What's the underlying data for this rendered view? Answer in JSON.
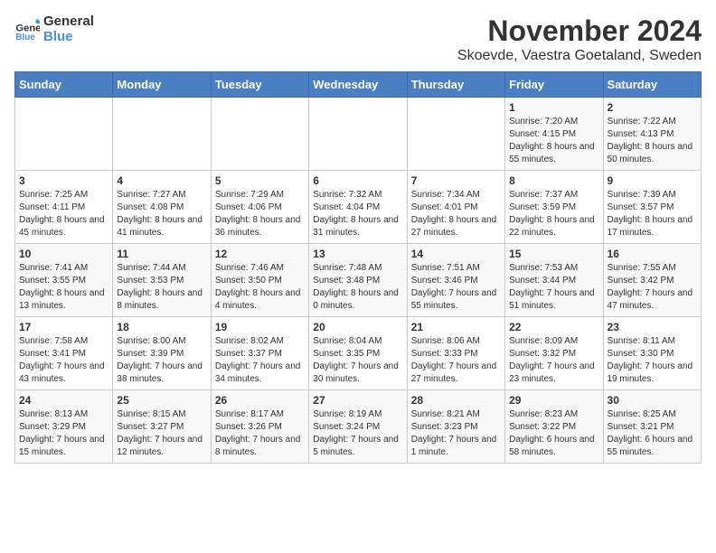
{
  "header": {
    "logo_line1": "General",
    "logo_line2": "Blue",
    "month": "November 2024",
    "location": "Skoevde, Vaestra Goetaland, Sweden"
  },
  "days_of_week": [
    "Sunday",
    "Monday",
    "Tuesday",
    "Wednesday",
    "Thursday",
    "Friday",
    "Saturday"
  ],
  "weeks": [
    [
      {
        "day": "",
        "info": ""
      },
      {
        "day": "",
        "info": ""
      },
      {
        "day": "",
        "info": ""
      },
      {
        "day": "",
        "info": ""
      },
      {
        "day": "",
        "info": ""
      },
      {
        "day": "1",
        "info": "Sunrise: 7:20 AM\nSunset: 4:15 PM\nDaylight: 8 hours and 55 minutes."
      },
      {
        "day": "2",
        "info": "Sunrise: 7:22 AM\nSunset: 4:13 PM\nDaylight: 8 hours and 50 minutes."
      }
    ],
    [
      {
        "day": "3",
        "info": "Sunrise: 7:25 AM\nSunset: 4:11 PM\nDaylight: 8 hours and 45 minutes."
      },
      {
        "day": "4",
        "info": "Sunrise: 7:27 AM\nSunset: 4:08 PM\nDaylight: 8 hours and 41 minutes."
      },
      {
        "day": "5",
        "info": "Sunrise: 7:29 AM\nSunset: 4:06 PM\nDaylight: 8 hours and 36 minutes."
      },
      {
        "day": "6",
        "info": "Sunrise: 7:32 AM\nSunset: 4:04 PM\nDaylight: 8 hours and 31 minutes."
      },
      {
        "day": "7",
        "info": "Sunrise: 7:34 AM\nSunset: 4:01 PM\nDaylight: 8 hours and 27 minutes."
      },
      {
        "day": "8",
        "info": "Sunrise: 7:37 AM\nSunset: 3:59 PM\nDaylight: 8 hours and 22 minutes."
      },
      {
        "day": "9",
        "info": "Sunrise: 7:39 AM\nSunset: 3:57 PM\nDaylight: 8 hours and 17 minutes."
      }
    ],
    [
      {
        "day": "10",
        "info": "Sunrise: 7:41 AM\nSunset: 3:55 PM\nDaylight: 8 hours and 13 minutes."
      },
      {
        "day": "11",
        "info": "Sunrise: 7:44 AM\nSunset: 3:53 PM\nDaylight: 8 hours and 8 minutes."
      },
      {
        "day": "12",
        "info": "Sunrise: 7:46 AM\nSunset: 3:50 PM\nDaylight: 8 hours and 4 minutes."
      },
      {
        "day": "13",
        "info": "Sunrise: 7:48 AM\nSunset: 3:48 PM\nDaylight: 8 hours and 0 minutes."
      },
      {
        "day": "14",
        "info": "Sunrise: 7:51 AM\nSunset: 3:46 PM\nDaylight: 7 hours and 55 minutes."
      },
      {
        "day": "15",
        "info": "Sunrise: 7:53 AM\nSunset: 3:44 PM\nDaylight: 7 hours and 51 minutes."
      },
      {
        "day": "16",
        "info": "Sunrise: 7:55 AM\nSunset: 3:42 PM\nDaylight: 7 hours and 47 minutes."
      }
    ],
    [
      {
        "day": "17",
        "info": "Sunrise: 7:58 AM\nSunset: 3:41 PM\nDaylight: 7 hours and 43 minutes."
      },
      {
        "day": "18",
        "info": "Sunrise: 8:00 AM\nSunset: 3:39 PM\nDaylight: 7 hours and 38 minutes."
      },
      {
        "day": "19",
        "info": "Sunrise: 8:02 AM\nSunset: 3:37 PM\nDaylight: 7 hours and 34 minutes."
      },
      {
        "day": "20",
        "info": "Sunrise: 8:04 AM\nSunset: 3:35 PM\nDaylight: 7 hours and 30 minutes."
      },
      {
        "day": "21",
        "info": "Sunrise: 8:06 AM\nSunset: 3:33 PM\nDaylight: 7 hours and 27 minutes."
      },
      {
        "day": "22",
        "info": "Sunrise: 8:09 AM\nSunset: 3:32 PM\nDaylight: 7 hours and 23 minutes."
      },
      {
        "day": "23",
        "info": "Sunrise: 8:11 AM\nSunset: 3:30 PM\nDaylight: 7 hours and 19 minutes."
      }
    ],
    [
      {
        "day": "24",
        "info": "Sunrise: 8:13 AM\nSunset: 3:29 PM\nDaylight: 7 hours and 15 minutes."
      },
      {
        "day": "25",
        "info": "Sunrise: 8:15 AM\nSunset: 3:27 PM\nDaylight: 7 hours and 12 minutes."
      },
      {
        "day": "26",
        "info": "Sunrise: 8:17 AM\nSunset: 3:26 PM\nDaylight: 7 hours and 8 minutes."
      },
      {
        "day": "27",
        "info": "Sunrise: 8:19 AM\nSunset: 3:24 PM\nDaylight: 7 hours and 5 minutes."
      },
      {
        "day": "28",
        "info": "Sunrise: 8:21 AM\nSunset: 3:23 PM\nDaylight: 7 hours and 1 minute."
      },
      {
        "day": "29",
        "info": "Sunrise: 8:23 AM\nSunset: 3:22 PM\nDaylight: 6 hours and 58 minutes."
      },
      {
        "day": "30",
        "info": "Sunrise: 8:25 AM\nSunset: 3:21 PM\nDaylight: 6 hours and 55 minutes."
      }
    ]
  ]
}
